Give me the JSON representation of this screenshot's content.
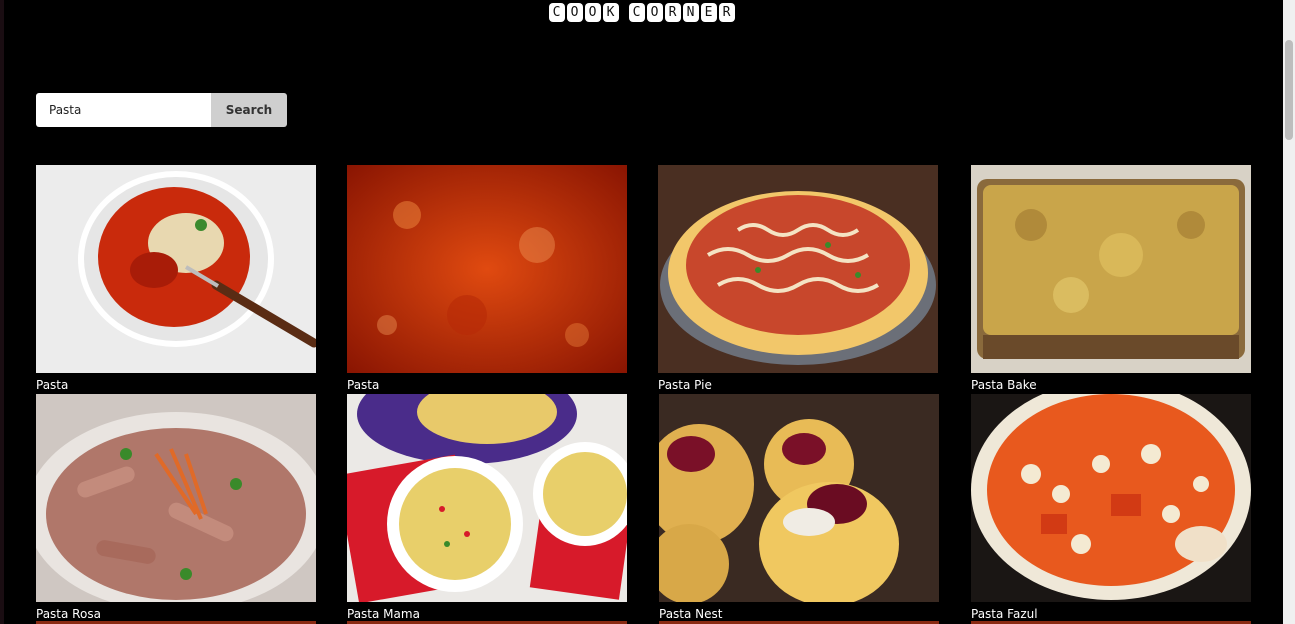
{
  "app": {
    "logo_words": [
      [
        "C",
        "O",
        "O",
        "K"
      ],
      [
        "C",
        "O",
        "R",
        "N",
        "E",
        "R"
      ]
    ]
  },
  "search": {
    "value": "Pasta",
    "button_label": "Search"
  },
  "recipes": [
    {
      "title": "Pasta"
    },
    {
      "title": "Pasta"
    },
    {
      "title": "Pasta Pie"
    },
    {
      "title": "Pasta Bake"
    },
    {
      "title": "Pasta Rosa"
    },
    {
      "title": "Pasta Mama"
    },
    {
      "title": "Pasta Nest"
    },
    {
      "title": "Pasta Fazul"
    }
  ]
}
